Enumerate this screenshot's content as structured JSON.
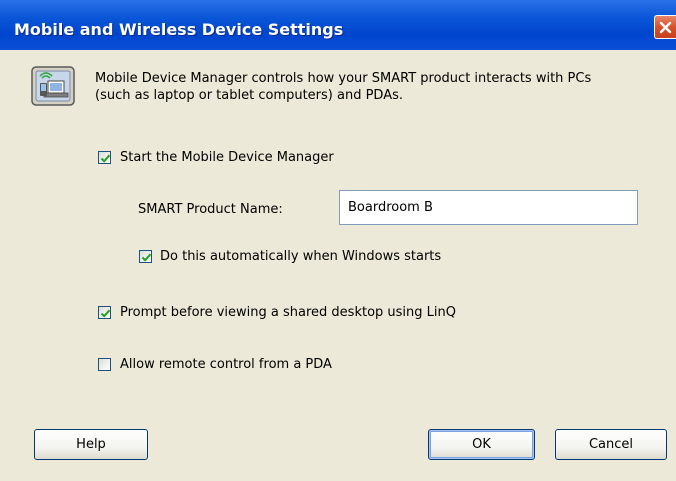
{
  "window": {
    "title": "Mobile and Wireless Device Settings"
  },
  "icons": {
    "info": "mobile-device-icon",
    "close": "close-icon"
  },
  "intro": {
    "line1": "Mobile Device Manager controls how your SMART product interacts with PCs",
    "line2": "(such as laptop or tablet computers) and PDAs."
  },
  "options": {
    "start_manager": {
      "label": "Start the Mobile Device Manager",
      "checked": true
    },
    "product_name": {
      "label": "SMART Product Name:",
      "value": "Boardroom B"
    },
    "auto_start": {
      "label": "Do this automatically when Windows starts",
      "checked": true
    },
    "prompt_linq": {
      "label": "Prompt before viewing a shared desktop using LinQ",
      "checked": true
    },
    "remote_pda": {
      "label": "Allow remote control from a PDA",
      "checked": false
    }
  },
  "buttons": {
    "help": "Help",
    "ok": "OK",
    "cancel": "Cancel"
  },
  "colors": {
    "titlebar": "#0a56d8",
    "dialog_bg": "#ece9d8",
    "checkmark": "#21a121",
    "close_red": "#d9512c"
  }
}
